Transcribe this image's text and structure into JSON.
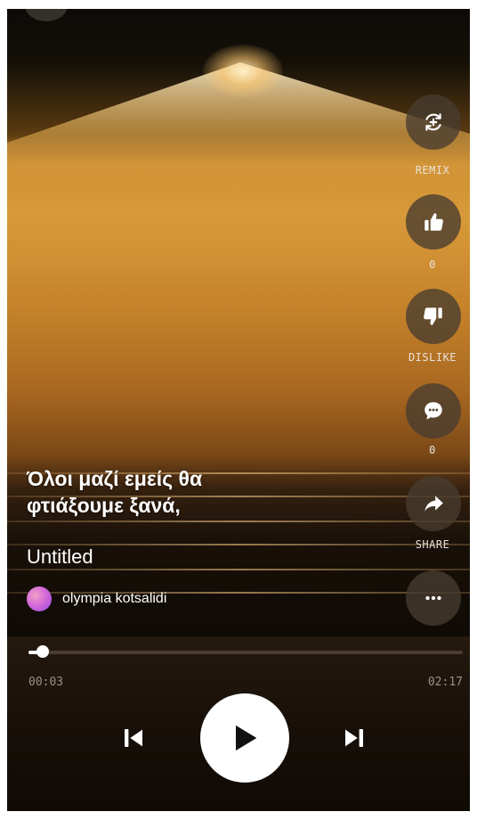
{
  "lyric": {
    "line1": "Όλοι μαζί εμείς θα",
    "line2": "φτιάξουμε ξανά,"
  },
  "track": {
    "title": "Untitled",
    "artist": "olympia kotsalidi"
  },
  "actions": {
    "remix_label": "REMIX",
    "like_count": "0",
    "dislike_label": "DISLIKE",
    "comment_count": "0",
    "share_label": "SHARE"
  },
  "icons": {
    "remix": "remix-icon",
    "like": "thumbs-up-icon",
    "dislike": "thumbs-down-icon",
    "comment": "comment-icon",
    "share": "share-arrow-icon",
    "more": "more-dots-icon",
    "prev": "skip-previous-icon",
    "play": "play-icon",
    "next": "skip-next-icon"
  },
  "player": {
    "current_time": "00:03",
    "total_time": "02:17",
    "progress_fraction": 0.022
  },
  "colors": {
    "accent_white": "#ffffff",
    "rail_button": "#4a3d31",
    "muted_text": "#9b8f82"
  }
}
